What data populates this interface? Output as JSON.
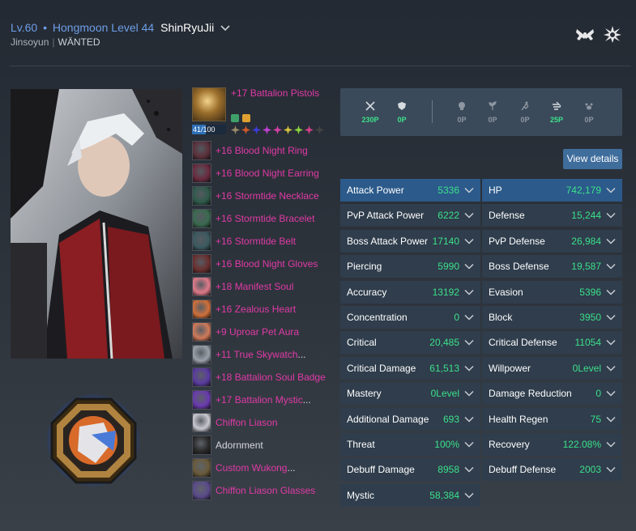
{
  "header": {
    "level": "Lv.60",
    "separator": "•",
    "hongmoon": "Hongmoon Level 44",
    "character_name": "ShinRyuJii",
    "server": "Jinsoyun",
    "clan": "WÄNTED"
  },
  "faction_icons": [
    "crossed-pistols-icon",
    "crest-icon"
  ],
  "weapon": {
    "name": "+17 Battalion Pistols",
    "durability": "41/100",
    "durability_fraction": 0.41
  },
  "gem_colors": [
    "#9a8a6a",
    "#d05a2a",
    "#3b3bd6",
    "#c23fd4",
    "#d43fa8",
    "#d4c23f",
    "#8ad43f",
    "#d43f8a",
    "#444444"
  ],
  "equipment": [
    {
      "label": "+16 Blood Night Ring",
      "tail": "",
      "color": "pink",
      "icon": "#5a2f3a"
    },
    {
      "label": "+16 Blood Night Earring",
      "tail": "",
      "color": "pink",
      "icon": "#6a2a3f"
    },
    {
      "label": "+16 Stormtide Necklace",
      "tail": "",
      "color": "pink",
      "icon": "#2f5a4a"
    },
    {
      "label": "+16 Stormtide Bracelet",
      "tail": "",
      "color": "pink",
      "icon": "#3a6a4f"
    },
    {
      "label": "+16 Stormtide Belt",
      "tail": "",
      "color": "pink",
      "icon": "#3a5a5f"
    },
    {
      "label": "+16 Blood Night Gloves",
      "tail": "",
      "color": "pink",
      "icon": "#6a2f2f"
    },
    {
      "label": "+18 Manifest Soul",
      "tail": "",
      "color": "pink",
      "icon": "#e07a8a"
    },
    {
      "label": "+16 Zealous Heart",
      "tail": "",
      "color": "pink",
      "icon": "#d0703a"
    },
    {
      "label": "+9 Uproar Pet Aura",
      "tail": "",
      "color": "pink",
      "icon": "#d07a5a"
    },
    {
      "label": "+11 True Skywatch",
      "tail": "...",
      "color": "pink",
      "icon": "#9aa0aa"
    },
    {
      "label": "+18 Battalion Soul Badge",
      "tail": "",
      "color": "pink",
      "icon": "#5a3aa0"
    },
    {
      "label": "+17 Battalion Mystic",
      "tail": "...",
      "color": "pink",
      "icon": "#6a3ab0"
    },
    {
      "label": "Chiffon Liason",
      "tail": "",
      "color": "pink",
      "icon": "#c8c8d0"
    },
    {
      "label": "Adornment",
      "tail": "",
      "color": "white",
      "icon": "#2a2a2a"
    },
    {
      "label": "Custom Wukong",
      "tail": "...",
      "color": "pink",
      "icon": "#6a5a3a"
    },
    {
      "label": "Chiffon Liason Glasses",
      "tail": "",
      "color": "pink",
      "icon": "#5a4a8a"
    }
  ],
  "training_points": [
    {
      "icon": "sword-icon",
      "value": "230P",
      "active": true
    },
    {
      "icon": "shield-icon",
      "value": "0P",
      "active": true
    },
    {
      "icon": "skull-icon",
      "value": "0P",
      "active": false
    },
    {
      "icon": "sprout-icon",
      "value": "0P",
      "active": false
    },
    {
      "icon": "running-icon",
      "value": "0P",
      "active": false
    },
    {
      "icon": "wind-icon",
      "value": "25P",
      "active": true
    },
    {
      "icon": "paw-icon",
      "value": "0P",
      "active": false
    }
  ],
  "view_details_label": "View details",
  "stats_left": [
    {
      "name": "Attack Power",
      "value": "5336"
    },
    {
      "name": "PvP Attack Power",
      "value": "6222"
    },
    {
      "name": "Boss Attack Power",
      "value": "17140"
    },
    {
      "name": "Piercing",
      "value": "5990"
    },
    {
      "name": "Accuracy",
      "value": "13192"
    },
    {
      "name": "Concentration",
      "value": "0"
    },
    {
      "name": "Critical",
      "value": "20,485"
    },
    {
      "name": "Critical Damage",
      "value": "61,513"
    },
    {
      "name": "Mastery",
      "value": "0Level"
    },
    {
      "name": "Additional Damage",
      "value": "693"
    },
    {
      "name": "Threat",
      "value": "100%"
    },
    {
      "name": "Debuff Damage",
      "value": "8958"
    },
    {
      "name": "Mystic",
      "value": "58,384"
    }
  ],
  "stats_right": [
    {
      "name": "HP",
      "value": "742,179"
    },
    {
      "name": "Defense",
      "value": "15,244"
    },
    {
      "name": "PvP Defense",
      "value": "26,984"
    },
    {
      "name": "Boss Defense",
      "value": "19,587"
    },
    {
      "name": "Evasion",
      "value": "5396"
    },
    {
      "name": "Block",
      "value": "3950"
    },
    {
      "name": "Critical Defense",
      "value": "11054"
    },
    {
      "name": "Willpower",
      "value": "0Level"
    },
    {
      "name": "Damage Reduction",
      "value": "0"
    },
    {
      "name": "Health Regen",
      "value": "75"
    },
    {
      "name": "Recovery",
      "value": "122.08%"
    },
    {
      "name": "Debuff Defense",
      "value": "2003"
    }
  ]
}
